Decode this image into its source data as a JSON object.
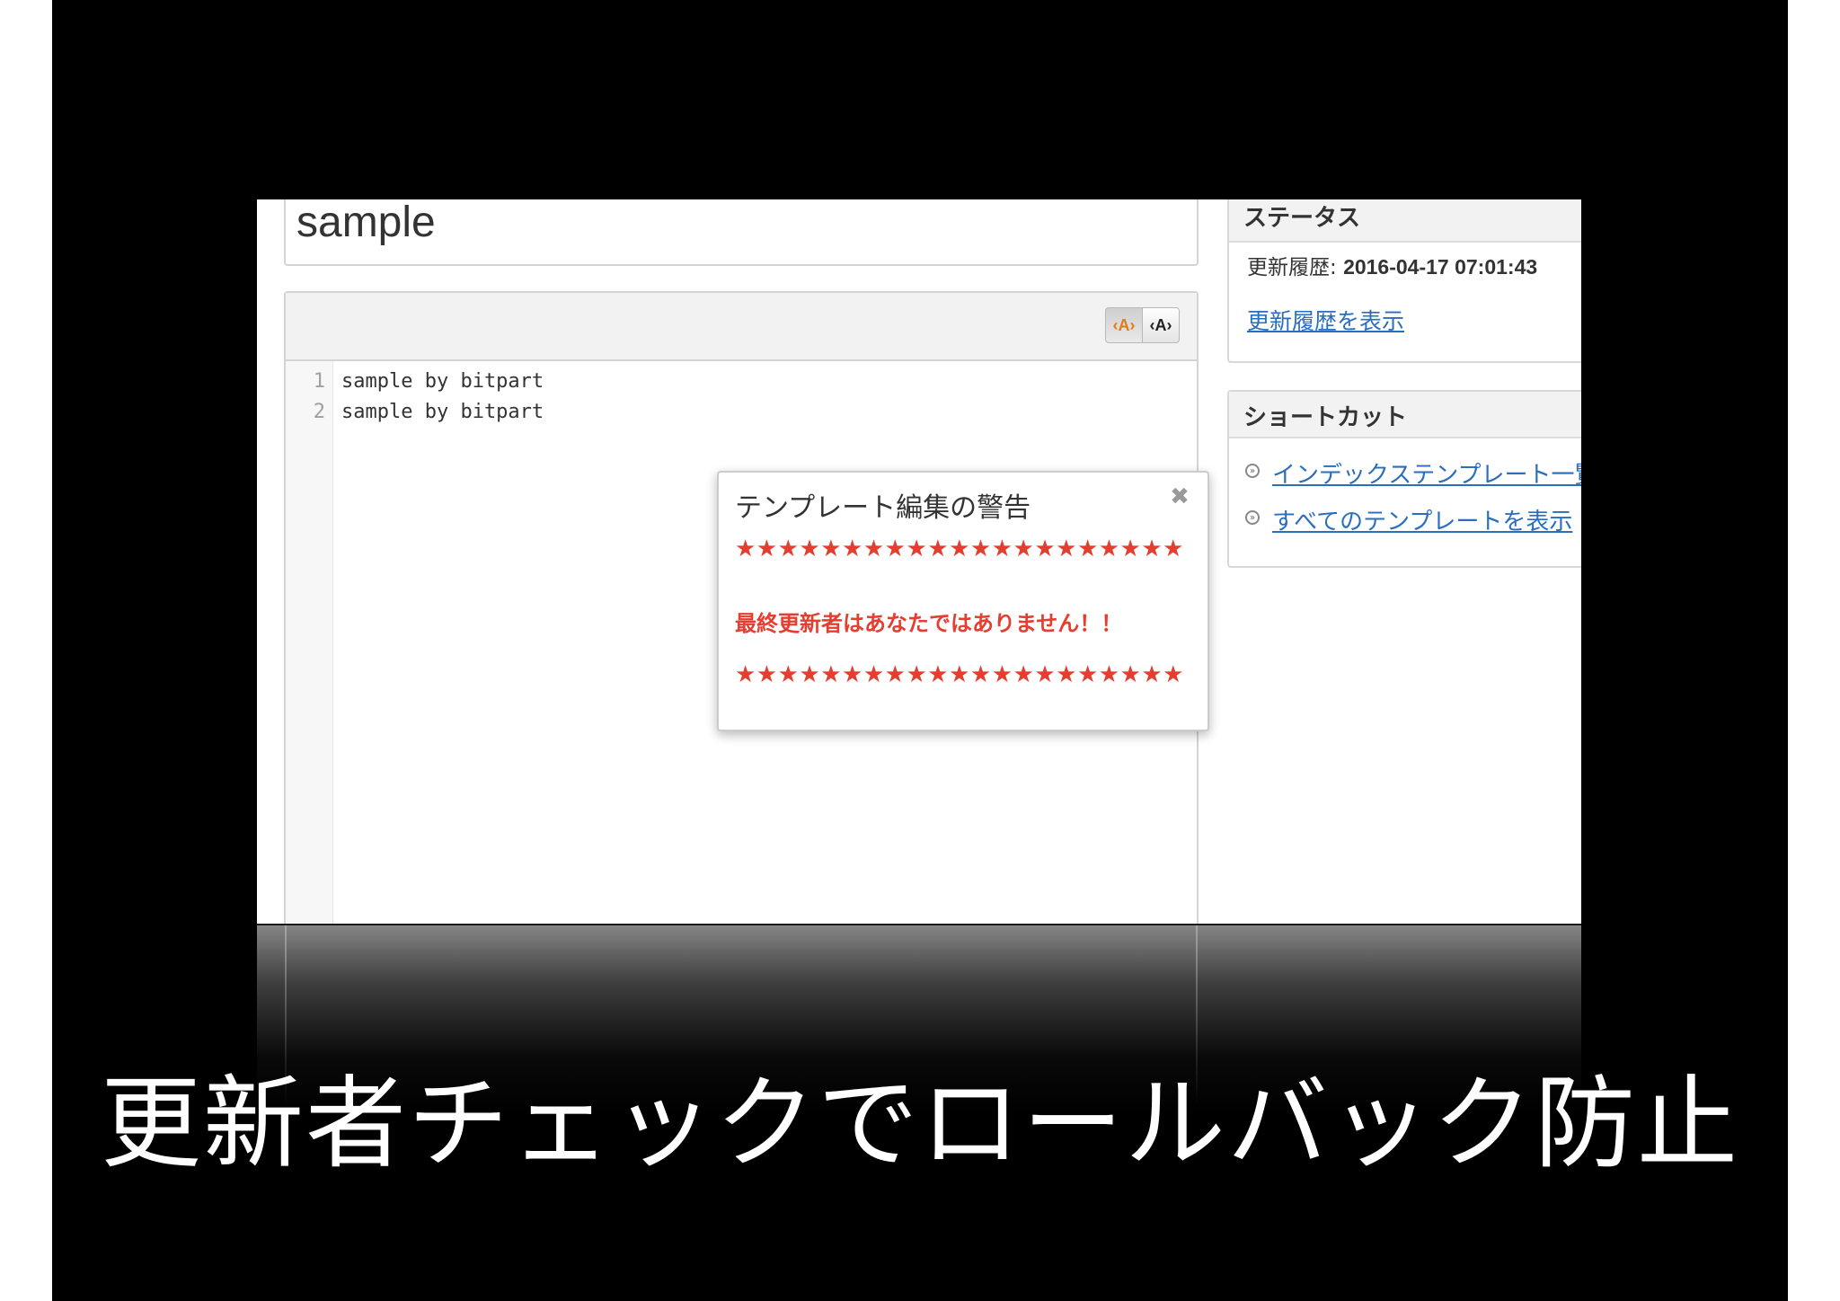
{
  "document": {
    "title": "sample"
  },
  "editor": {
    "toolbar": {
      "highlight_on_label": "‹A›",
      "highlight_off_label": "‹A›"
    },
    "lines": [
      {
        "number": "1",
        "text": "sample by bitpart"
      },
      {
        "number": "2",
        "text": "sample by bitpart"
      }
    ]
  },
  "dialog": {
    "title": "テンプレート編集の警告",
    "close_glyph": "✖",
    "stars_top": "★★★★★★★★★★★★★★★★★★★★★",
    "message": "最終更新者はあなたではありません！！",
    "stars_bottom": "★★★★★★★★★★★★★★★★★★★★★",
    "warning_color": "#e53d2f"
  },
  "status_panel": {
    "title": "ステータス",
    "history_label": "更新履歴: ",
    "history_value": "2016-04-17 07:01:43",
    "history_link": "更新履歴を表示"
  },
  "shortcut_panel": {
    "title": "ショートカット",
    "items": [
      {
        "label": "インデックステンプレート一覧"
      },
      {
        "label": "すべてのテンプレートを表示"
      }
    ],
    "link_color": "#2a6ebd"
  },
  "caption": {
    "text": "更新者チェックでロールバック防止"
  }
}
